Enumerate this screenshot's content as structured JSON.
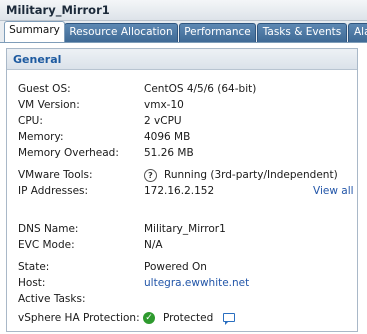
{
  "window": {
    "title": "Military_Mirror1"
  },
  "tabs": [
    {
      "label": "Summary",
      "active": true
    },
    {
      "label": "Resource Allocation",
      "active": false
    },
    {
      "label": "Performance",
      "active": false
    },
    {
      "label": "Tasks & Events",
      "active": false
    },
    {
      "label": "Ala",
      "active": false
    }
  ],
  "general": {
    "title": "General",
    "rows": {
      "guest_os": {
        "label": "Guest OS:",
        "value": "CentOS 4/5/6 (64-bit)"
      },
      "vm_version": {
        "label": "VM Version:",
        "value": "vmx-10"
      },
      "cpu": {
        "label": "CPU:",
        "value": "2 vCPU"
      },
      "memory": {
        "label": "Memory:",
        "value": "4096 MB"
      },
      "memory_overhead": {
        "label": "Memory Overhead:",
        "value": "51.26 MB"
      },
      "vmware_tools": {
        "label": "VMware Tools:",
        "value": "Running (3rd-party/Independent)",
        "icon": "help-icon"
      },
      "ip_addresses": {
        "label": "IP Addresses:",
        "value": "172.16.2.152",
        "link": "View all"
      },
      "dns_name": {
        "label": "DNS Name:",
        "value": "Military_Mirror1"
      },
      "evc_mode": {
        "label": "EVC Mode:",
        "value": "N/A"
      },
      "state": {
        "label": "State:",
        "value": "Powered On"
      },
      "host": {
        "label": "Host:",
        "value": "ultegra.ewwhite.net"
      },
      "active_tasks": {
        "label": "Active Tasks:",
        "value": ""
      },
      "vsphere_ha": {
        "label": "vSphere HA Protection:",
        "value": "Protected",
        "icon": "check-circle-icon"
      }
    }
  },
  "colors": {
    "tab_blue": "#4a76a2",
    "link_blue": "#2155a8",
    "header_blue": "#1d5aa0",
    "ok_green": "#2e9a2e"
  }
}
